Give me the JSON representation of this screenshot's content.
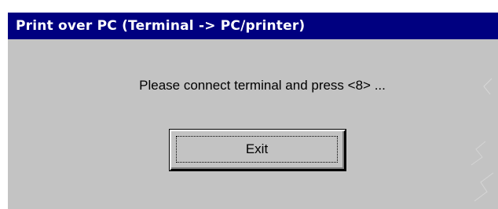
{
  "window": {
    "title": "Print over PC (Terminal -> PC/printer)"
  },
  "dialog": {
    "message": "Please connect terminal and press <8> ...",
    "exit_label": "Exit"
  },
  "colors": {
    "titlebar": "#000080",
    "face": "#c3c3c3",
    "title_text": "#ffffff"
  }
}
